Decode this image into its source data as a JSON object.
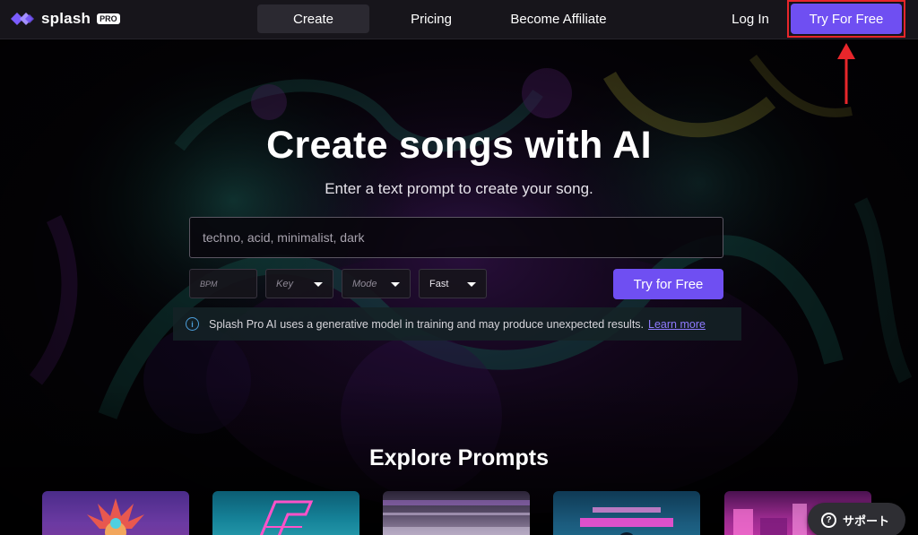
{
  "nav": {
    "brand": "splash",
    "brand_badge": "PRO",
    "links": {
      "create": "Create",
      "pricing": "Pricing",
      "affiliate": "Become Affiliate"
    },
    "login": "Log In",
    "try_free": "Try For Free"
  },
  "hero": {
    "title": "Create songs with AI",
    "subtitle": "Enter a text prompt to create your song."
  },
  "prompt": {
    "placeholder": "techno, acid, minimalist, dark",
    "value": ""
  },
  "controls": {
    "bpm_placeholder": "BPM",
    "key_placeholder": "Key",
    "mode_placeholder": "Mode",
    "speed_value": "Fast"
  },
  "cta": {
    "try_free": "Try for Free"
  },
  "notice": {
    "icon": "info-icon",
    "text": "Splash Pro AI uses a generative model in training and may produce unexpected results.",
    "link": "Learn more"
  },
  "explore": {
    "heading": "Explore Prompts"
  },
  "support": {
    "icon": "question-icon",
    "label": "サポート"
  },
  "colors": {
    "accent": "#6f4ff2",
    "annotation_red": "#e8262b",
    "link": "#8f7bff",
    "info": "#4c9edb"
  }
}
